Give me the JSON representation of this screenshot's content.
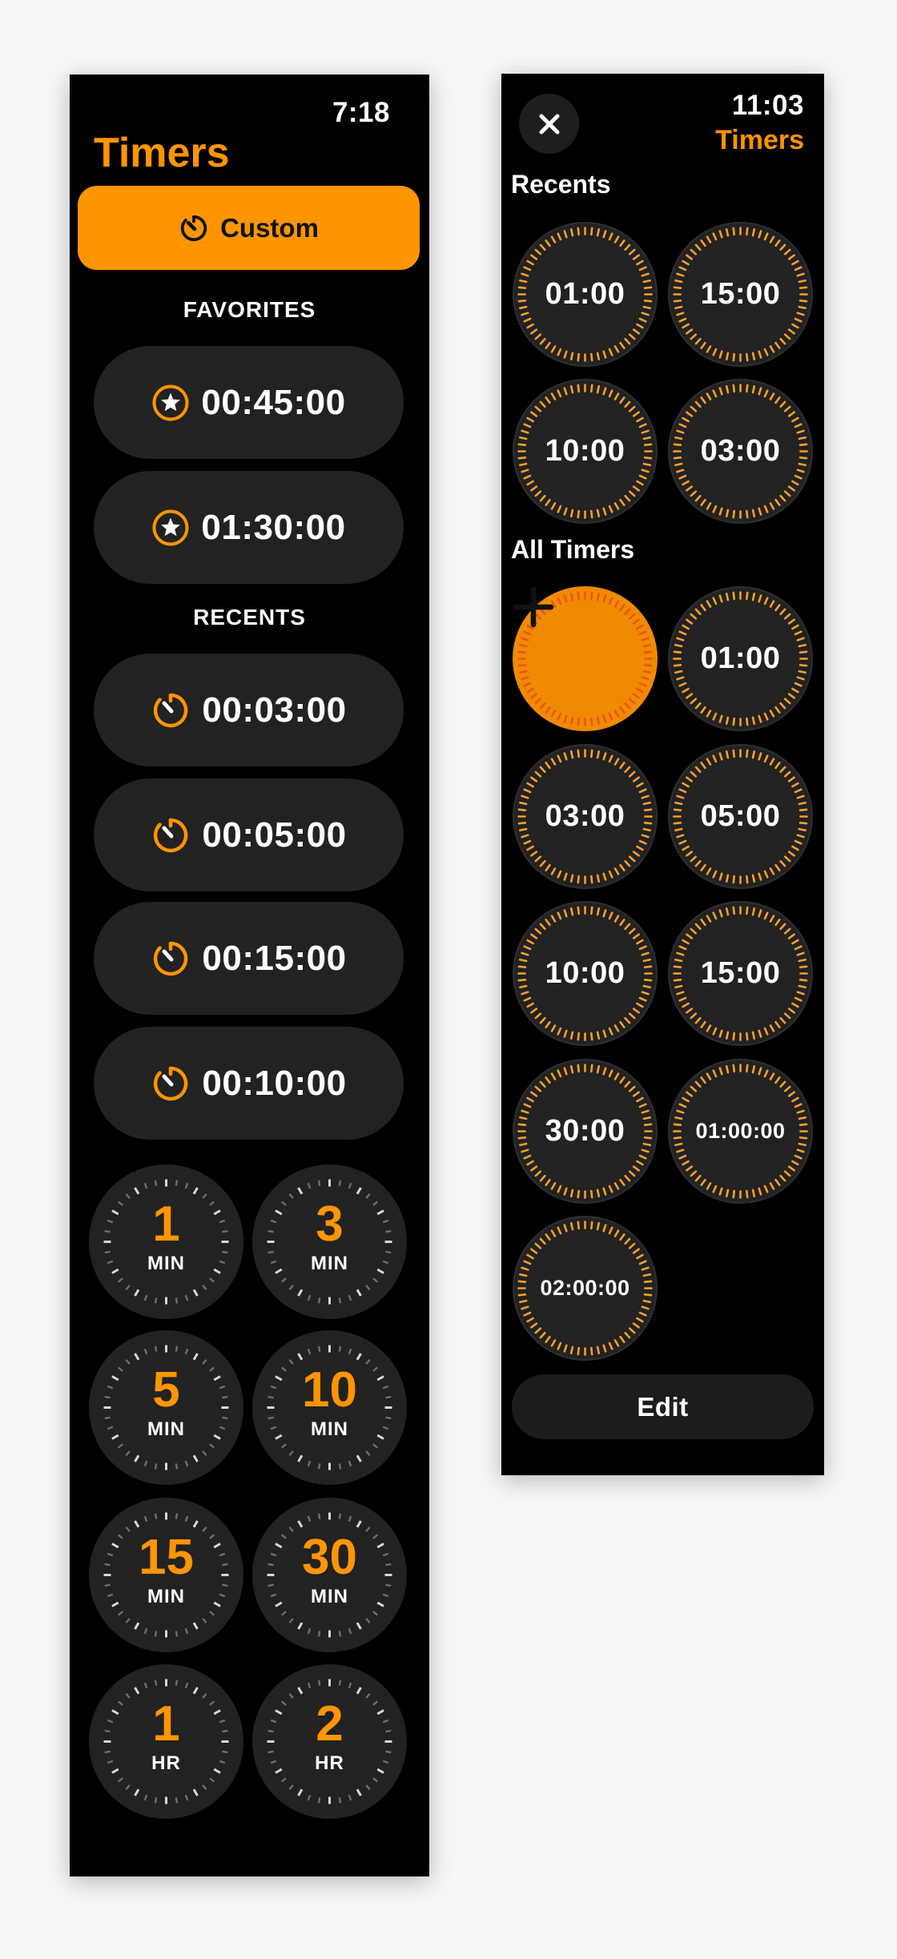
{
  "colors": {
    "accent": "#ff9500",
    "pill_bg": "#222222",
    "screen_bg": "#000000",
    "plus_bg": "#f08a00",
    "plus_ticks": "#e8561a"
  },
  "left_screen": {
    "time": "7:18",
    "title": "Timers",
    "custom_button": {
      "label": "Custom",
      "icon": "timer-icon"
    },
    "favorites": {
      "heading": "FAVORITES",
      "items": [
        {
          "label": "00:45:00",
          "icon": "star-circle-icon"
        },
        {
          "label": "01:30:00",
          "icon": "star-circle-icon"
        }
      ]
    },
    "recents": {
      "heading": "RECENTS",
      "items": [
        {
          "label": "00:03:00",
          "icon": "timer-icon"
        },
        {
          "label": "00:05:00",
          "icon": "timer-icon"
        },
        {
          "label": "00:15:00",
          "icon": "timer-icon"
        },
        {
          "label": "00:10:00",
          "icon": "timer-icon"
        }
      ]
    },
    "presets": [
      {
        "value": "1",
        "unit": "MIN"
      },
      {
        "value": "3",
        "unit": "MIN"
      },
      {
        "value": "5",
        "unit": "MIN"
      },
      {
        "value": "10",
        "unit": "MIN"
      },
      {
        "value": "15",
        "unit": "MIN"
      },
      {
        "value": "30",
        "unit": "MIN"
      },
      {
        "value": "1",
        "unit": "HR"
      },
      {
        "value": "2",
        "unit": "HR"
      }
    ]
  },
  "right_screen": {
    "time": "11:03",
    "title": "Timers",
    "close_icon": "close-icon",
    "recents": {
      "heading": "Recents",
      "items": [
        "01:00",
        "15:00",
        "10:00",
        "03:00"
      ]
    },
    "all_timers": {
      "heading": "All Timers",
      "add_icon": "plus-icon",
      "items": [
        "01:00",
        "03:00",
        "05:00",
        "10:00",
        "15:00",
        "30:00",
        "01:00:00",
        "02:00:00"
      ]
    },
    "edit_label": "Edit"
  }
}
